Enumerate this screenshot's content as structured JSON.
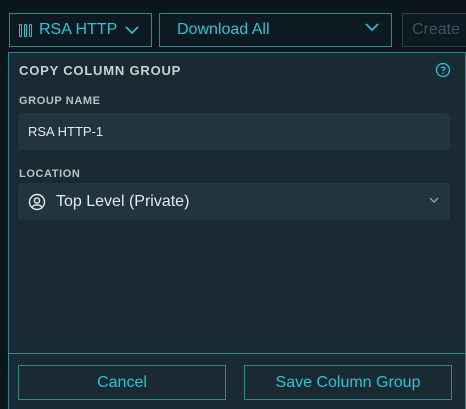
{
  "toolbar": {
    "columns_label": "RSA HTTP",
    "download_label": "Download All",
    "create_label": "Create"
  },
  "dialog": {
    "title": "COPY COLUMN GROUP",
    "group_name_label": "GROUP NAME",
    "group_name_value": "RSA HTTP-1",
    "location_label": "LOCATION",
    "location_value": "Top Level (Private)",
    "cancel_label": "Cancel",
    "save_label": "Save Column Group"
  },
  "icons": {
    "columns": "columns-icon",
    "chevron": "chevron-down-icon",
    "help": "help-icon",
    "user": "user-icon"
  },
  "colors": {
    "accent": "#20c8d6",
    "border": "#2b8a8e",
    "panel_bg": "#1a2a33",
    "field_bg": "#22343d",
    "page_bg": "#0b151c"
  }
}
